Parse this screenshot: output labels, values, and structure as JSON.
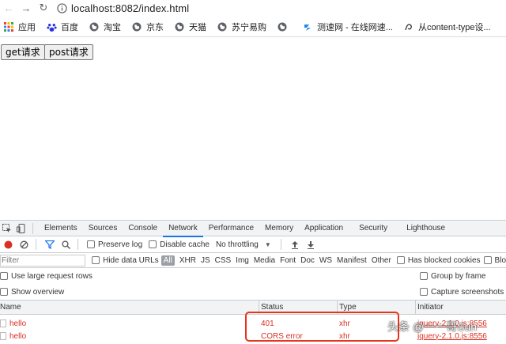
{
  "browser": {
    "url": "localhost:8082/index.html",
    "bookmarks": [
      {
        "label": "应用",
        "icon": "apps-grid-icon"
      },
      {
        "label": "百度",
        "icon": "baidu-paw-icon"
      },
      {
        "label": "淘宝",
        "icon": "globe-icon"
      },
      {
        "label": "京东",
        "icon": "globe-icon"
      },
      {
        "label": "天猫",
        "icon": "globe-icon"
      },
      {
        "label": "苏宁易购",
        "icon": "globe-icon"
      },
      {
        "label": "",
        "icon": "globe-icon"
      },
      {
        "label": "测速网 - 在线网速...",
        "icon": "speedtest-icon"
      },
      {
        "label": "从content-type设...",
        "icon": "script-icon"
      }
    ]
  },
  "page": {
    "get_button": "get请求",
    "post_button": "post请求"
  },
  "devtools": {
    "tabs": [
      "Elements",
      "Sources",
      "Console",
      "Network",
      "Performance",
      "Memory",
      "Application",
      "Security",
      "Lighthouse"
    ],
    "active_tab": "Network",
    "toolbar": {
      "preserve_log": "Preserve log",
      "disable_cache": "Disable cache",
      "throttling": "No throttling"
    },
    "filter": {
      "placeholder": "Filter",
      "hide_data_urls": "Hide data URLs",
      "types": [
        "All",
        "XHR",
        "JS",
        "CSS",
        "Img",
        "Media",
        "Font",
        "Doc",
        "WS",
        "Manifest",
        "Other"
      ],
      "has_blocked_cookies": "Has blocked cookies",
      "blocked_requests": "Blo"
    },
    "options": {
      "large_rows": "Use large request rows",
      "group_by_frame": "Group by frame",
      "show_overview": "Show overview",
      "capture_screenshots": "Capture screenshots"
    },
    "columns": {
      "name": "Name",
      "status": "Status",
      "type": "Type",
      "initiator": "Initiator"
    },
    "rows": [
      {
        "name": "hello",
        "status": "401",
        "type": "xhr",
        "initiator": "jquery-2.1.0.js:8556"
      },
      {
        "name": "hello",
        "status": "CORS error",
        "type": "xhr",
        "initiator": "jquery-2.1.0.js:8556"
      }
    ]
  },
  "watermark": {
    "text": "头条 @一一哥Sun"
  },
  "colors": {
    "accent": "#1a73e8",
    "error": "#d93025",
    "annotation": "#e8341c"
  }
}
